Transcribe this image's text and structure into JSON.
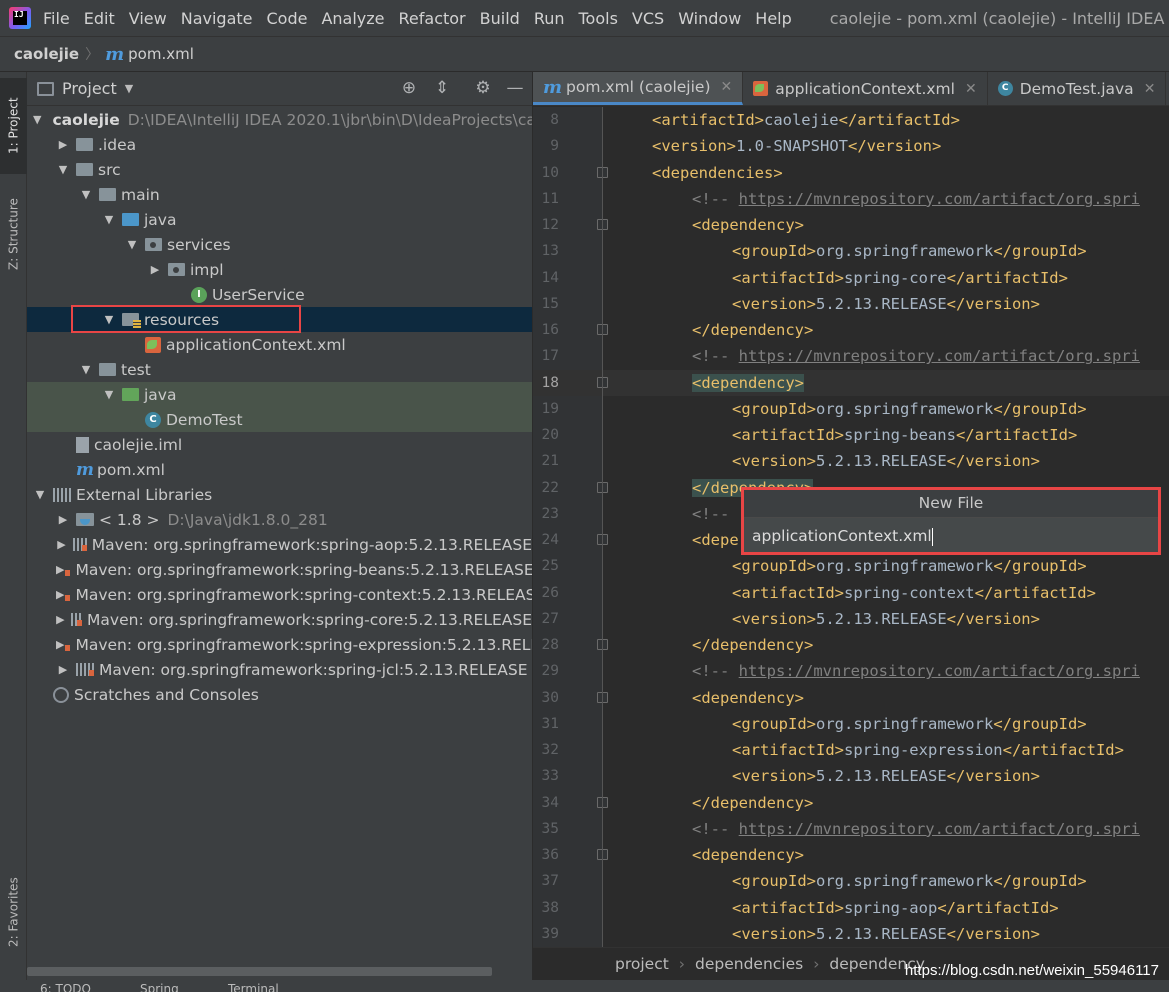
{
  "menubar": {
    "items": [
      "File",
      "Edit",
      "View",
      "Navigate",
      "Code",
      "Analyze",
      "Refactor",
      "Build",
      "Run",
      "Tools",
      "VCS",
      "Window",
      "Help"
    ],
    "window_title": "caolejie - pom.xml (caolejie) - IntelliJ IDEA"
  },
  "navbar": {
    "project": "caolejie",
    "file": "pom.xml",
    "file_icon": "m"
  },
  "left_stripe": {
    "project_tab": "1: Project",
    "structure_tab": "Z: Structure",
    "favorites_tab": "2: Favorites"
  },
  "project_panel": {
    "title": "Project",
    "tree": [
      {
        "label": "caolejie",
        "detail": "D:\\IDEA\\IntelliJ IDEA 2020.1\\jbr\\bin\\D\\IdeaProjects\\cao",
        "level": 0,
        "arrow": "open",
        "icon": "folder",
        "bold": true
      },
      {
        "label": ".idea",
        "level": 1,
        "arrow": "closed",
        "icon": "folder"
      },
      {
        "label": "src",
        "level": 1,
        "arrow": "open",
        "icon": "folder"
      },
      {
        "label": "main",
        "level": 2,
        "arrow": "open",
        "icon": "folder"
      },
      {
        "label": "java",
        "level": 3,
        "arrow": "open",
        "icon": "folder-blue"
      },
      {
        "label": "services",
        "level": 4,
        "arrow": "open",
        "icon": "pkg"
      },
      {
        "label": "impl",
        "level": 5,
        "arrow": "closed",
        "icon": "pkg"
      },
      {
        "label": "UserService",
        "level": 6,
        "arrow": "none",
        "icon": "interface"
      },
      {
        "label": "resources",
        "level": 3,
        "arrow": "open",
        "icon": "res",
        "selected": true
      },
      {
        "label": "applicationContext.xml",
        "level": 4,
        "arrow": "none",
        "icon": "xml"
      },
      {
        "label": "test",
        "level": 2,
        "arrow": "open",
        "icon": "folder"
      },
      {
        "label": "java",
        "level": 3,
        "arrow": "open",
        "icon": "folder-green",
        "test": true
      },
      {
        "label": "DemoTest",
        "level": 4,
        "arrow": "none",
        "icon": "class",
        "test": true
      },
      {
        "label": "caolejie.iml",
        "level": 1,
        "arrow": "none",
        "icon": "iml"
      },
      {
        "label": "pom.xml",
        "level": 1,
        "arrow": "none",
        "icon": "m"
      },
      {
        "label": "External Libraries",
        "level": 0,
        "arrow": "open",
        "icon": "lib"
      },
      {
        "label": "< 1.8 >",
        "detail": "D:\\Java\\jdk1.8.0_281",
        "level": 1,
        "arrow": "closed",
        "icon": "jdk"
      },
      {
        "label": "Maven: org.springframework:spring-aop:5.2.13.RELEASE",
        "level": 1,
        "arrow": "closed",
        "icon": "maven"
      },
      {
        "label": "Maven: org.springframework:spring-beans:5.2.13.RELEASE",
        "level": 1,
        "arrow": "closed",
        "icon": "maven"
      },
      {
        "label": "Maven: org.springframework:spring-context:5.2.13.RELEASE",
        "level": 1,
        "arrow": "closed",
        "icon": "maven"
      },
      {
        "label": "Maven: org.springframework:spring-core:5.2.13.RELEASE",
        "level": 1,
        "arrow": "closed",
        "icon": "maven"
      },
      {
        "label": "Maven: org.springframework:spring-expression:5.2.13.RELE",
        "level": 1,
        "arrow": "closed",
        "icon": "maven"
      },
      {
        "label": "Maven: org.springframework:spring-jcl:5.2.13.RELEASE",
        "level": 1,
        "arrow": "closed",
        "icon": "maven"
      },
      {
        "label": "Scratches and Consoles",
        "level": 0,
        "arrow": "none",
        "icon": "scratch"
      }
    ]
  },
  "editor": {
    "tabs": [
      {
        "label": "pom.xml (caolejie)",
        "icon": "m",
        "active": true
      },
      {
        "label": "applicationContext.xml",
        "icon": "xml"
      },
      {
        "label": "DemoTest.java",
        "icon": "class"
      }
    ],
    "current_line": 18,
    "lines": [
      {
        "n": 8,
        "indent": 2,
        "parts": [
          [
            "tag",
            "<artifactId>"
          ],
          [
            "txt",
            "caolejie"
          ],
          [
            "tag",
            "</artifactId>"
          ]
        ]
      },
      {
        "n": 9,
        "indent": 2,
        "parts": [
          [
            "tag",
            "<version>"
          ],
          [
            "txt",
            "1.0-SNAPSHOT"
          ],
          [
            "tag",
            "</version>"
          ]
        ]
      },
      {
        "n": 10,
        "indent": 2,
        "fold": true,
        "parts": [
          [
            "tag",
            "<dependencies>"
          ]
        ]
      },
      {
        "n": 11,
        "indent": 3,
        "parts": [
          [
            "cmt",
            "<!-- "
          ],
          [
            "url",
            "https://mvnrepository.com/artifact/org.spri"
          ]
        ]
      },
      {
        "n": 12,
        "indent": 3,
        "fold": true,
        "parts": [
          [
            "tag",
            "<dependency>"
          ]
        ]
      },
      {
        "n": 13,
        "indent": 4,
        "parts": [
          [
            "tag",
            "<groupId>"
          ],
          [
            "txt",
            "org.springframework"
          ],
          [
            "tag",
            "</groupId>"
          ]
        ]
      },
      {
        "n": 14,
        "indent": 4,
        "parts": [
          [
            "tag",
            "<artifactId>"
          ],
          [
            "txt",
            "spring-core"
          ],
          [
            "tag",
            "</artifactId>"
          ]
        ]
      },
      {
        "n": 15,
        "indent": 4,
        "parts": [
          [
            "tag",
            "<version>"
          ],
          [
            "txt",
            "5.2.13.RELEASE"
          ],
          [
            "tag",
            "</version>"
          ]
        ]
      },
      {
        "n": 16,
        "indent": 3,
        "fold": true,
        "parts": [
          [
            "tag",
            "</dependency>"
          ]
        ]
      },
      {
        "n": 17,
        "indent": 3,
        "parts": [
          [
            "cmt",
            "<!-- "
          ],
          [
            "url",
            "https://mvnrepository.com/artifact/org.spri"
          ]
        ]
      },
      {
        "n": 18,
        "indent": 3,
        "fold": true,
        "parts": [
          [
            "taghl",
            "<dependency>"
          ]
        ]
      },
      {
        "n": 19,
        "indent": 4,
        "parts": [
          [
            "tag",
            "<groupId>"
          ],
          [
            "txt",
            "org.springframework"
          ],
          [
            "tag",
            "</groupId>"
          ]
        ]
      },
      {
        "n": 20,
        "indent": 4,
        "parts": [
          [
            "tag",
            "<artifactId>"
          ],
          [
            "txt",
            "spring-beans"
          ],
          [
            "tag",
            "</artifactId>"
          ]
        ]
      },
      {
        "n": 21,
        "indent": 4,
        "parts": [
          [
            "tag",
            "<version>"
          ],
          [
            "txt",
            "5.2.13.RELEASE"
          ],
          [
            "tag",
            "</version>"
          ]
        ]
      },
      {
        "n": 22,
        "indent": 3,
        "fold": true,
        "parts": [
          [
            "taghl",
            "</dependency>"
          ]
        ]
      },
      {
        "n": 23,
        "indent": 3,
        "parts": [
          [
            "cmt",
            "<!-- "
          ]
        ]
      },
      {
        "n": 24,
        "indent": 3,
        "fold": true,
        "parts": [
          [
            "tag",
            "<depe"
          ]
        ]
      },
      {
        "n": 25,
        "indent": 4,
        "parts": [
          [
            "tag",
            "<groupId>"
          ],
          [
            "txt",
            "org.springframework"
          ],
          [
            "tag",
            "</groupId>"
          ]
        ]
      },
      {
        "n": 26,
        "indent": 4,
        "parts": [
          [
            "tag",
            "<artifactId>"
          ],
          [
            "txt",
            "spring-context"
          ],
          [
            "tag",
            "</artifactId>"
          ]
        ]
      },
      {
        "n": 27,
        "indent": 4,
        "parts": [
          [
            "tag",
            "<version>"
          ],
          [
            "txt",
            "5.2.13.RELEASE"
          ],
          [
            "tag",
            "</version>"
          ]
        ]
      },
      {
        "n": 28,
        "indent": 3,
        "fold": true,
        "parts": [
          [
            "tag",
            "</dependency>"
          ]
        ]
      },
      {
        "n": 29,
        "indent": 3,
        "parts": [
          [
            "cmt",
            "<!-- "
          ],
          [
            "url",
            "https://mvnrepository.com/artifact/org.spri"
          ]
        ]
      },
      {
        "n": 30,
        "indent": 3,
        "fold": true,
        "parts": [
          [
            "tag",
            "<dependency>"
          ]
        ]
      },
      {
        "n": 31,
        "indent": 4,
        "parts": [
          [
            "tag",
            "<groupId>"
          ],
          [
            "txt",
            "org.springframework"
          ],
          [
            "tag",
            "</groupId>"
          ]
        ]
      },
      {
        "n": 32,
        "indent": 4,
        "parts": [
          [
            "tag",
            "<artifactId>"
          ],
          [
            "txt",
            "spring-expression"
          ],
          [
            "tag",
            "</artifactId>"
          ]
        ]
      },
      {
        "n": 33,
        "indent": 4,
        "parts": [
          [
            "tag",
            "<version>"
          ],
          [
            "txt",
            "5.2.13.RELEASE"
          ],
          [
            "tag",
            "</version>"
          ]
        ]
      },
      {
        "n": 34,
        "indent": 3,
        "fold": true,
        "parts": [
          [
            "tag",
            "</dependency>"
          ]
        ]
      },
      {
        "n": 35,
        "indent": 3,
        "parts": [
          [
            "cmt",
            "<!-- "
          ],
          [
            "url",
            "https://mvnrepository.com/artifact/org.spri"
          ]
        ]
      },
      {
        "n": 36,
        "indent": 3,
        "fold": true,
        "parts": [
          [
            "tag",
            "<dependency>"
          ]
        ]
      },
      {
        "n": 37,
        "indent": 4,
        "parts": [
          [
            "tag",
            "<groupId>"
          ],
          [
            "txt",
            "org.springframework"
          ],
          [
            "tag",
            "</groupId>"
          ]
        ]
      },
      {
        "n": 38,
        "indent": 4,
        "parts": [
          [
            "tag",
            "<artifactId>"
          ],
          [
            "txt",
            "spring-aop"
          ],
          [
            "tag",
            "</artifactId>"
          ]
        ]
      },
      {
        "n": 39,
        "indent": 4,
        "parts": [
          [
            "tag",
            "<version>"
          ],
          [
            "txt",
            "5.2.13.RELEASE"
          ],
          [
            "tag",
            "</version>"
          ]
        ]
      }
    ],
    "breadcrumb": [
      "project",
      "dependencies",
      "dependency"
    ]
  },
  "new_file_popup": {
    "title": "New File",
    "value": "applicationContext.xml"
  },
  "bottom_bar": {
    "todo": "6: TODO",
    "spring": "Spring",
    "terminal": "Terminal"
  },
  "watermark": "https://blog.csdn.net/weixin_55946117",
  "colors": {
    "accent": "#4a88c7",
    "highlight_box": "#e84545",
    "selection": "#0d293e",
    "tag": "#e8bf6a"
  }
}
